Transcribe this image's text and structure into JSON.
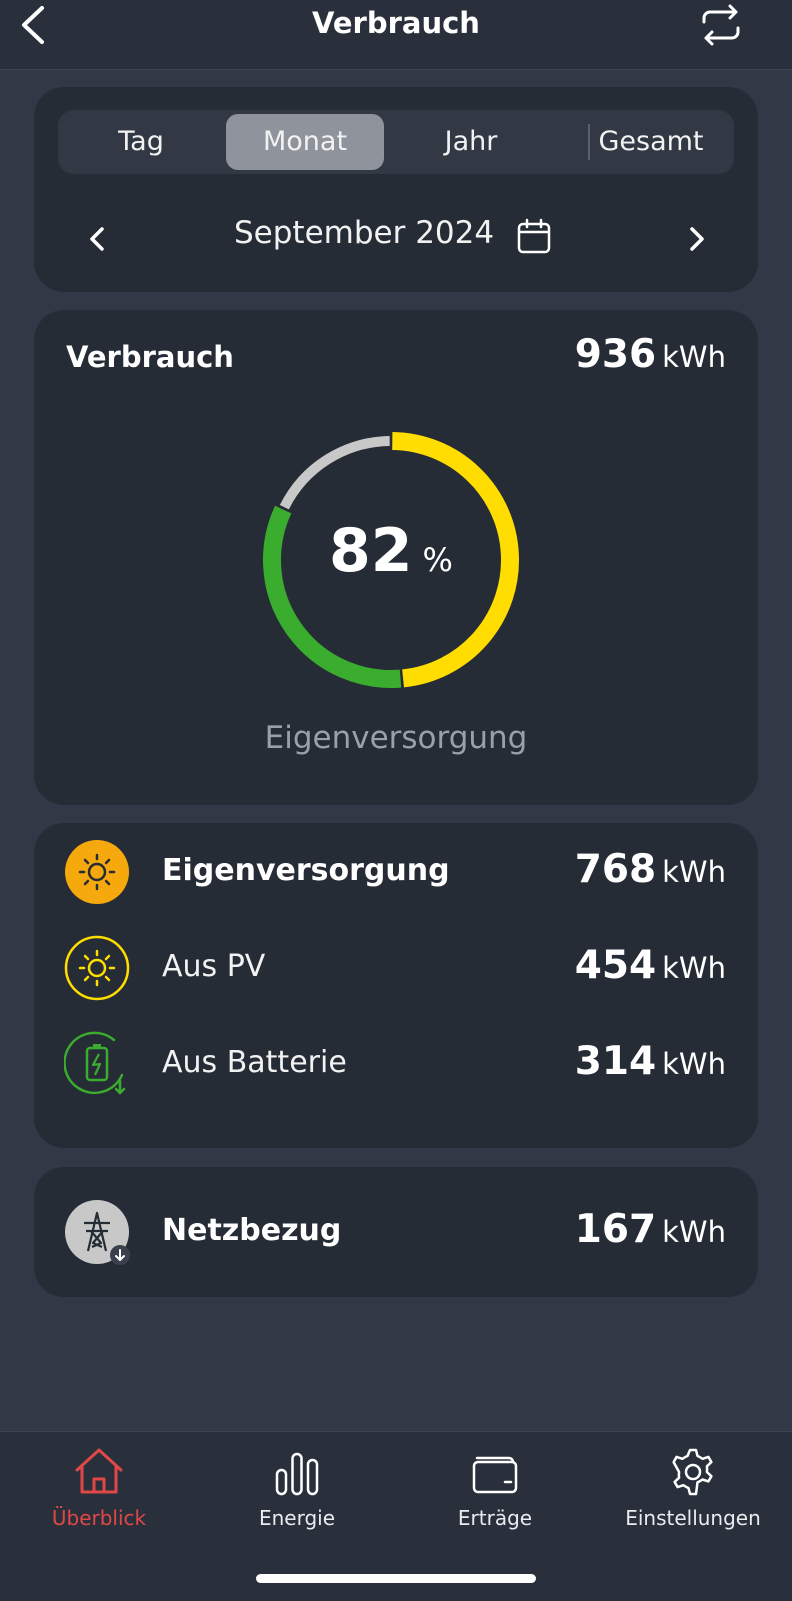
{
  "header": {
    "title": "Verbrauch"
  },
  "period": {
    "tabs": [
      {
        "label": "Tag"
      },
      {
        "label": "Monat",
        "active": true
      },
      {
        "label": "Jahr"
      },
      {
        "label": "Gesamt"
      }
    ],
    "current": "September 2024"
  },
  "consumption": {
    "label": "Verbrauch",
    "value": "936",
    "unit": "kWh",
    "self_supply_percent": "82",
    "percent_unit": "%",
    "caption": "Eigenversorgung",
    "ring_segments": [
      {
        "name": "Aus PV",
        "value": 454,
        "color": "#ffdd00"
      },
      {
        "name": "Aus Batterie",
        "value": 314,
        "color": "#3aac2e"
      },
      {
        "name": "Netzbezug",
        "value": 167,
        "color": "#c8c8c8"
      }
    ]
  },
  "breakdown": {
    "items": [
      {
        "name": "Eigenversorgung",
        "value": "768",
        "unit": "kWh",
        "icon": "sun-filled-icon"
      },
      {
        "name": "Aus PV",
        "value": "454",
        "unit": "kWh",
        "icon": "sun-outline-icon"
      },
      {
        "name": "Aus Batterie",
        "value": "314",
        "unit": "kWh",
        "icon": "battery-icon"
      }
    ]
  },
  "grid": {
    "name": "Netzbezug",
    "value": "167",
    "unit": "kWh",
    "icon": "power-tower-icon"
  },
  "nav": {
    "items": [
      {
        "label": "Überblick",
        "icon": "home-icon",
        "active": true
      },
      {
        "label": "Energie",
        "icon": "bar-chart-icon"
      },
      {
        "label": "Erträge",
        "icon": "wallet-icon"
      },
      {
        "label": "Einstellungen",
        "icon": "gear-icon"
      }
    ]
  },
  "colors": {
    "accent_active": "#e04848",
    "pv_yellow": "#ffdd00",
    "battery_green": "#3aac2e",
    "sun_orange": "#f5a90c"
  }
}
